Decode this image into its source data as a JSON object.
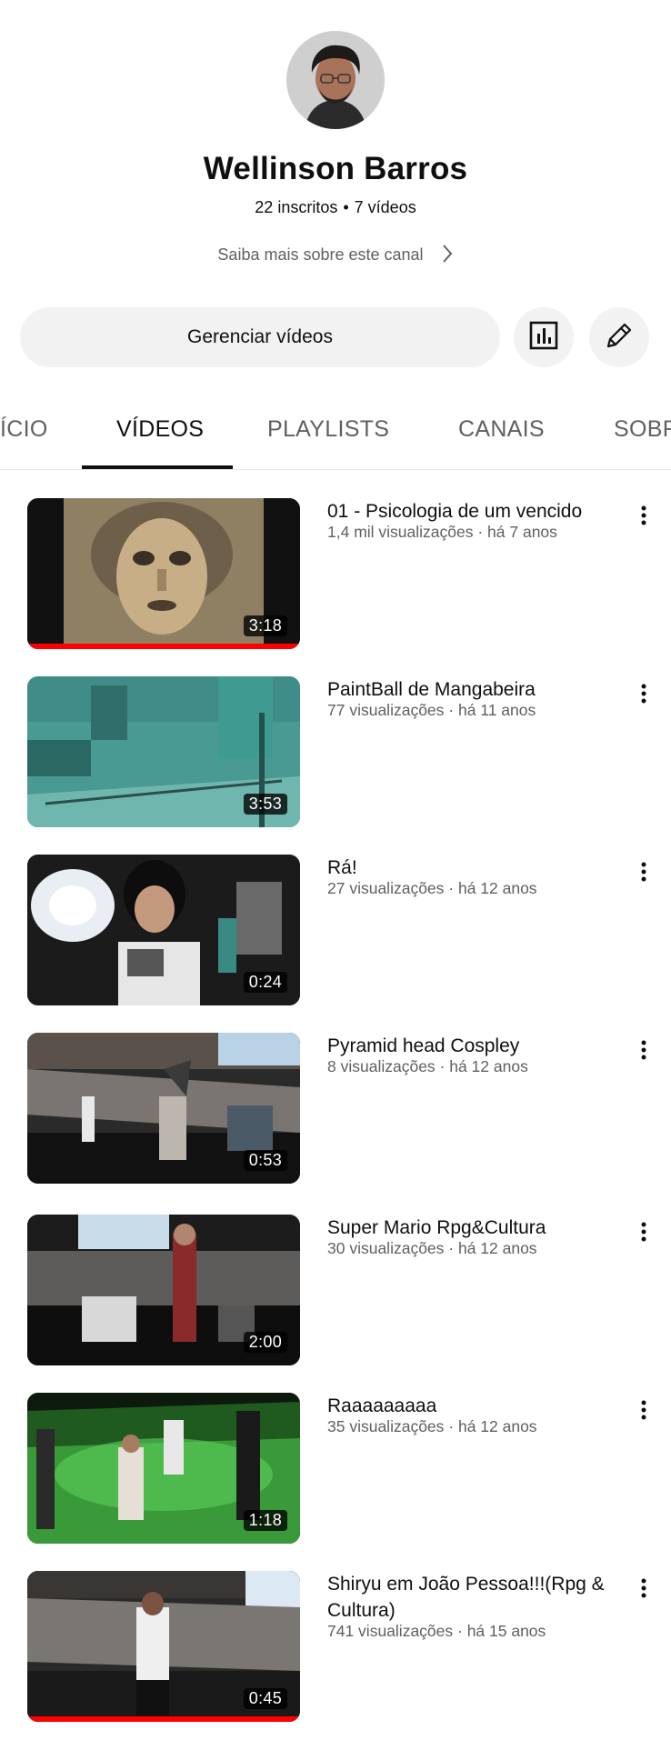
{
  "channel": {
    "name": "Wellinson Barros",
    "subscribers": "22 inscritos",
    "separator": "•",
    "video_count": "7 vídeos",
    "about_label": "Saiba mais sobre este canal",
    "manage_label": "Gerenciar vídeos"
  },
  "tabs": [
    {
      "label": "ÍCIO"
    },
    {
      "label": "VÍDEOS"
    },
    {
      "label": "PLAYLISTS"
    },
    {
      "label": "CANAIS"
    },
    {
      "label": "SOBR"
    }
  ],
  "active_tab": "VÍDEOS",
  "videos": [
    {
      "title": "01 - Psicologia de um vencido",
      "meta": "1,4 mil visualizações · há 7 anos",
      "duration": "3:18",
      "watched_fraction": 1.0
    },
    {
      "title": "PaintBall de Mangabeira",
      "meta": "77 visualizações · há 11 anos",
      "duration": "3:53",
      "watched_fraction": 0
    },
    {
      "title": "Rá!",
      "meta": "27 visualizações · há 12 anos",
      "duration": "0:24",
      "watched_fraction": 0
    },
    {
      "title": "Pyramid head Cospley",
      "meta": "8 visualizações · há 12 anos",
      "duration": "0:53",
      "watched_fraction": 0
    },
    {
      "title": "Super Mario Rpg&Cultura",
      "meta": "30 visualizações · há 12 anos",
      "duration": "2:00",
      "watched_fraction": 0
    },
    {
      "title": "Raaaaaaaaa",
      "meta": "35 visualizações · há 12 anos",
      "duration": "1:18",
      "watched_fraction": 0
    },
    {
      "title": "Shiryu em João Pessoa!!!(Rpg & Cultura)",
      "meta": "741 visualizações · há 15 anos",
      "duration": "0:45",
      "watched_fraction": 1.0
    }
  ],
  "colors": {
    "progress": "#ff0000",
    "button_bg": "#f2f2f2",
    "secondary_text": "#606060"
  },
  "icons": {
    "about": "chevron-right-icon",
    "analytics": "analytics-icon",
    "edit": "pencil-icon",
    "more": "more-vert-icon"
  }
}
